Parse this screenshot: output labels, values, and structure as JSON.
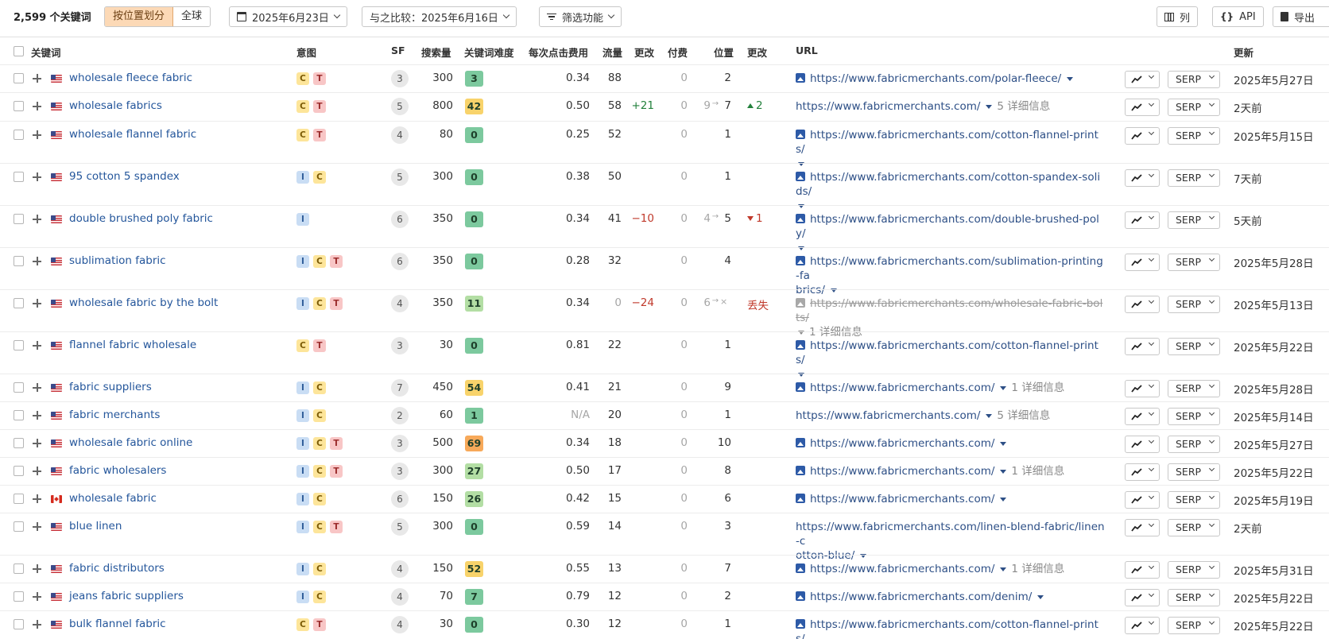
{
  "toolbar": {
    "keyword_count": "2,599 个关键词",
    "segment": [
      "按位置划分",
      "全球"
    ],
    "date": "2025年6月23日",
    "compare_label": "与之比较：",
    "compare_date": "2025年6月16日",
    "filters": "筛选功能",
    "columns": "列",
    "api": "API",
    "export": "导出"
  },
  "headers": {
    "keyword": "关键词",
    "intent": "意图",
    "sf": "SF",
    "volume": "搜索量",
    "kd": "关键词难度",
    "cpc": "每次点击费用",
    "traffic": "流量",
    "traffic_change": "更改",
    "paid": "付费",
    "position": "位置",
    "position_change": "更改",
    "url": "URL",
    "updated": "更新"
  },
  "colors": {
    "kd_green": "#7cc99e",
    "kd_light_green": "#b3dea4",
    "kd_yellow": "#f8d36b",
    "kd_orange": "#f7a95a",
    "link": "#24569b",
    "positive": "#23813c",
    "negative": "#c0392b"
  },
  "rows": [
    {
      "keyword": "wholesale fleece fabric",
      "flag": "us",
      "intents": [
        "C",
        "T"
      ],
      "sf": "3",
      "volume": "300",
      "kd": "3",
      "kd_color": "#7cc99e",
      "cpc": "0.34",
      "traffic": "88",
      "traffic_change": "",
      "paid": "0",
      "position": "2",
      "position_prev": "",
      "position_change": "",
      "change_dir": "",
      "url_line1": "https://www.fabricmerchants.com/polar-fleece/",
      "url_line2": "",
      "url_icon": true,
      "details": ""
    },
    {
      "keyword": "wholesale fabrics",
      "flag": "us",
      "intents": [
        "C",
        "T"
      ],
      "sf": "5",
      "volume": "800",
      "kd": "42",
      "kd_color": "#f8d36b",
      "cpc": "0.50",
      "traffic": "58",
      "traffic_change": "+21",
      "paid": "0",
      "position": "7",
      "position_prev": "9",
      "position_change": "2",
      "change_dir": "up",
      "url_line1": "https://www.fabricmerchants.com/",
      "url_line2": "",
      "url_icon": false,
      "details": "5 详细信息"
    },
    {
      "keyword": "wholesale flannel fabric",
      "flag": "us",
      "intents": [
        "C",
        "T"
      ],
      "sf": "4",
      "volume": "80",
      "kd": "0",
      "kd_color": "#7cc99e",
      "cpc": "0.25",
      "traffic": "52",
      "traffic_change": "",
      "paid": "0",
      "position": "1",
      "position_prev": "",
      "position_change": "",
      "change_dir": "",
      "url_line1": "https://www.fabricmerchants.com/cotton-flannel-prints/",
      "url_line2": "",
      "url_icon": true,
      "details": ""
    },
    {
      "keyword": "95 cotton 5 spandex",
      "flag": "us",
      "intents": [
        "I",
        "C"
      ],
      "sf": "5",
      "volume": "300",
      "kd": "0",
      "kd_color": "#7cc99e",
      "cpc": "0.38",
      "traffic": "50",
      "traffic_change": "",
      "paid": "0",
      "position": "1",
      "position_prev": "",
      "position_change": "",
      "change_dir": "",
      "url_line1": "https://www.fabricmerchants.com/cotton-spandex-solids/",
      "url_line2": "",
      "url_icon": true,
      "details": ""
    },
    {
      "keyword": "double brushed poly fabric",
      "flag": "us",
      "intents": [
        "I"
      ],
      "sf": "6",
      "volume": "350",
      "kd": "0",
      "kd_color": "#7cc99e",
      "cpc": "0.34",
      "traffic": "41",
      "traffic_change": "−10",
      "paid": "0",
      "position": "5",
      "position_prev": "4",
      "position_change": "1",
      "change_dir": "down",
      "url_line1": "https://www.fabricmerchants.com/double-brushed-poly/",
      "url_line2": "",
      "url_icon": true,
      "details": ""
    },
    {
      "keyword": "sublimation fabric",
      "flag": "us",
      "intents": [
        "I",
        "C",
        "T"
      ],
      "sf": "6",
      "volume": "350",
      "kd": "0",
      "kd_color": "#7cc99e",
      "cpc": "0.28",
      "traffic": "32",
      "traffic_change": "",
      "paid": "0",
      "position": "4",
      "position_prev": "",
      "position_change": "",
      "change_dir": "",
      "url_line1": "https://www.fabricmerchants.com/sublimation-printing-fa",
      "url_line2": "brics/",
      "url_icon": true,
      "details": ""
    },
    {
      "keyword": "wholesale fabric by the bolt",
      "flag": "us",
      "intents": [
        "I",
        "C",
        "T"
      ],
      "sf": "4",
      "volume": "350",
      "kd": "11",
      "kd_color": "#b3dea4",
      "cpc": "0.34",
      "traffic": "0",
      "traffic_change": "−24",
      "paid": "0",
      "position": "×",
      "position_prev": "6",
      "position_change": "丢失",
      "change_dir": "lost",
      "url_line1": "https://www.fabricmerchants.com/wholesale-fabric-bolts/",
      "url_line2": "",
      "url_icon": true,
      "details": "1 详细信息"
    },
    {
      "keyword": "flannel fabric wholesale",
      "flag": "us",
      "intents": [
        "C",
        "T"
      ],
      "sf": "3",
      "volume": "30",
      "kd": "0",
      "kd_color": "#7cc99e",
      "cpc": "0.81",
      "traffic": "22",
      "traffic_change": "",
      "paid": "0",
      "position": "1",
      "position_prev": "",
      "position_change": "",
      "change_dir": "",
      "url_line1": "https://www.fabricmerchants.com/cotton-flannel-prints/",
      "url_line2": "",
      "url_icon": true,
      "details": ""
    },
    {
      "keyword": "fabric suppliers",
      "flag": "us",
      "intents": [
        "I",
        "C"
      ],
      "sf": "7",
      "volume": "450",
      "kd": "54",
      "kd_color": "#f8d36b",
      "cpc": "0.41",
      "traffic": "21",
      "traffic_change": "",
      "paid": "0",
      "position": "9",
      "position_prev": "",
      "position_change": "",
      "change_dir": "",
      "url_line1": "https://www.fabricmerchants.com/",
      "url_line2": "",
      "url_icon": true,
      "details": "1 详细信息"
    },
    {
      "keyword": "fabric merchants",
      "flag": "us",
      "intents": [
        "I",
        "C"
      ],
      "sf": "2",
      "volume": "60",
      "kd": "1",
      "kd_color": "#7cc99e",
      "cpc": "N/A",
      "traffic": "20",
      "traffic_change": "",
      "paid": "0",
      "position": "1",
      "position_prev": "",
      "position_change": "",
      "change_dir": "",
      "url_line1": "https://www.fabricmerchants.com/",
      "url_line2": "",
      "url_icon": false,
      "details": "5 详细信息"
    },
    {
      "keyword": "wholesale fabric online",
      "flag": "us",
      "intents": [
        "I",
        "C",
        "T"
      ],
      "sf": "3",
      "volume": "500",
      "kd": "69",
      "kd_color": "#f7a95a",
      "cpc": "0.34",
      "traffic": "18",
      "traffic_change": "",
      "paid": "0",
      "position": "10",
      "position_prev": "",
      "position_change": "",
      "change_dir": "",
      "url_line1": "https://www.fabricmerchants.com/",
      "url_line2": "",
      "url_icon": true,
      "details": ""
    },
    {
      "keyword": "fabric wholesalers",
      "flag": "us",
      "intents": [
        "I",
        "C",
        "T"
      ],
      "sf": "3",
      "volume": "300",
      "kd": "27",
      "kd_color": "#b3dea4",
      "cpc": "0.50",
      "traffic": "17",
      "traffic_change": "",
      "paid": "0",
      "position": "8",
      "position_prev": "",
      "position_change": "",
      "change_dir": "",
      "url_line1": "https://www.fabricmerchants.com/",
      "url_line2": "",
      "url_icon": true,
      "details": "1 详细信息"
    },
    {
      "keyword": "wholesale fabric",
      "flag": "ca",
      "intents": [
        "I",
        "C"
      ],
      "sf": "6",
      "volume": "150",
      "kd": "26",
      "kd_color": "#b3dea4",
      "cpc": "0.42",
      "traffic": "15",
      "traffic_change": "",
      "paid": "0",
      "position": "6",
      "position_prev": "",
      "position_change": "",
      "change_dir": "",
      "url_line1": "https://www.fabricmerchants.com/",
      "url_line2": "",
      "url_icon": true,
      "details": ""
    },
    {
      "keyword": "blue linen",
      "flag": "us",
      "intents": [
        "I",
        "C",
        "T"
      ],
      "sf": "5",
      "volume": "300",
      "kd": "0",
      "kd_color": "#7cc99e",
      "cpc": "0.59",
      "traffic": "14",
      "traffic_change": "",
      "paid": "0",
      "position": "3",
      "position_prev": "",
      "position_change": "",
      "change_dir": "",
      "url_line1": "https://www.fabricmerchants.com/linen-blend-fabric/linen-c",
      "url_line2": "otton-blue/",
      "url_icon": false,
      "details": ""
    },
    {
      "keyword": "fabric distributors",
      "flag": "us",
      "intents": [
        "I",
        "C"
      ],
      "sf": "4",
      "volume": "150",
      "kd": "52",
      "kd_color": "#f8d36b",
      "cpc": "0.55",
      "traffic": "13",
      "traffic_change": "",
      "paid": "0",
      "position": "7",
      "position_prev": "",
      "position_change": "",
      "change_dir": "",
      "url_line1": "https://www.fabricmerchants.com/",
      "url_line2": "",
      "url_icon": true,
      "details": "1 详细信息"
    },
    {
      "keyword": "jeans fabric suppliers",
      "flag": "us",
      "intents": [
        "I",
        "C"
      ],
      "sf": "4",
      "volume": "70",
      "kd": "7",
      "kd_color": "#7cc99e",
      "cpc": "0.79",
      "traffic": "12",
      "traffic_change": "",
      "paid": "0",
      "position": "2",
      "position_prev": "",
      "position_change": "",
      "change_dir": "",
      "url_line1": "https://www.fabricmerchants.com/denim/",
      "url_line2": "",
      "url_icon": true,
      "details": ""
    },
    {
      "keyword": "bulk flannel fabric",
      "flag": "us",
      "intents": [
        "C",
        "T"
      ],
      "sf": "4",
      "volume": "30",
      "kd": "0",
      "kd_color": "#7cc99e",
      "cpc": "0.30",
      "traffic": "12",
      "traffic_change": "",
      "paid": "0",
      "position": "1",
      "position_prev": "",
      "position_change": "",
      "change_dir": "",
      "url_line1": "https://www.fabricmerchants.com/cotton-flannel-prints/",
      "url_line2": "",
      "url_icon": true,
      "details": ""
    }
  ],
  "serp_label": "SERP",
  "updated": [
    "2025年5月27日",
    "2天前",
    "2025年5月15日",
    "7天前",
    "5天前",
    "2025年5月28日",
    "2025年5月13日",
    "2025年5月22日",
    "2025年5月28日",
    "2025年5月14日",
    "2025年5月27日",
    "2025年5月22日",
    "2025年5月19日",
    "2天前",
    "2025年5月31日",
    "2025年5月22日",
    "2025年5月22日"
  ]
}
